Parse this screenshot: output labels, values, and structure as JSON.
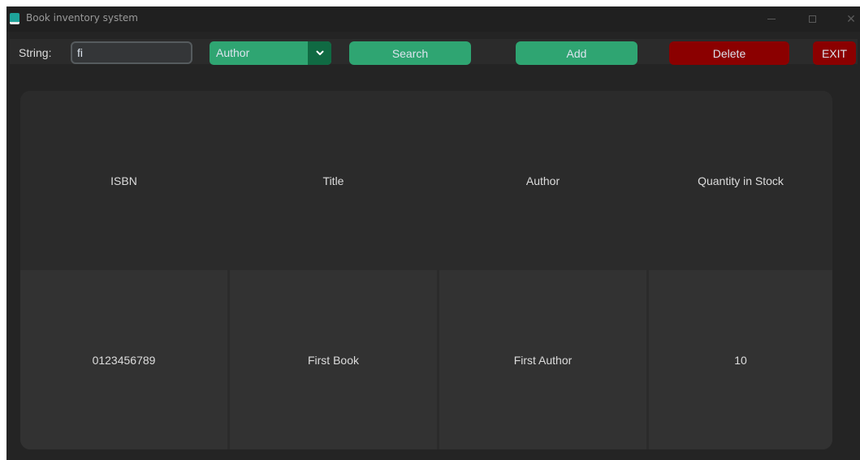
{
  "window": {
    "title": "Book inventory system",
    "icon": "book-app-icon",
    "controls": [
      "minimize-icon",
      "maximize-icon",
      "close-icon"
    ]
  },
  "toolbar": {
    "string_label": "String:",
    "search_value": "fi",
    "search_placeholder": "",
    "field_select": {
      "selected": "Author",
      "icon": "chevron-down-icon"
    },
    "search_label": "Search",
    "add_label": "Add",
    "delete_label": "Delete",
    "exit_label": "EXIT"
  },
  "table": {
    "columns": [
      "ISBN",
      "Title",
      "Author",
      "Quantity in Stock"
    ],
    "rows": [
      [
        "0123456789",
        "First Book",
        "First Author",
        "10"
      ]
    ]
  },
  "colors": {
    "accent_green": "#2fa572",
    "dropdown_arrow_bg": "#106a43",
    "danger_red": "#8b0000",
    "window_bg": "#242424",
    "header_cell_bg": "#2b2b2b",
    "body_cell_bg": "#323232"
  }
}
